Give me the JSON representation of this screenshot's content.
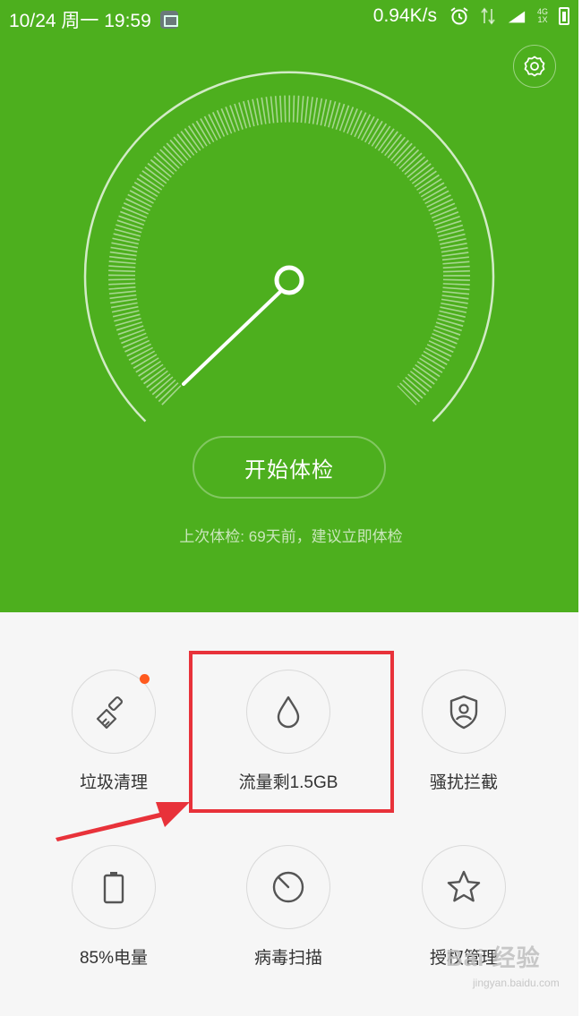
{
  "status_bar": {
    "datetime": "10/24 周一 19:59",
    "speed": "0.94K/s",
    "net_top": "4G",
    "net_bottom": "1X"
  },
  "header": {
    "settings_icon": "gear-icon",
    "start_button_label": "开始体检",
    "last_check_text": "上次体检: 69天前，建议立即体检"
  },
  "tools": [
    {
      "label": "垃圾清理",
      "icon": "broom-icon",
      "badge": true
    },
    {
      "label": "流量剩1.5GB",
      "icon": "water-drop-icon",
      "badge": false
    },
    {
      "label": "骚扰拦截",
      "icon": "shield-user-icon",
      "badge": false
    },
    {
      "label": "85%电量",
      "icon": "battery-icon",
      "badge": false
    },
    {
      "label": "病毒扫描",
      "icon": "scan-icon",
      "badge": false
    },
    {
      "label": "授权管理",
      "icon": "star-icon",
      "badge": false
    }
  ],
  "watermark": {
    "main": "Bai 经验",
    "sub": "jingyan.baidu.com"
  },
  "colors": {
    "header_green": "#4daf1e",
    "highlight_red": "#e8323a",
    "badge_orange": "#ff5a1f"
  }
}
